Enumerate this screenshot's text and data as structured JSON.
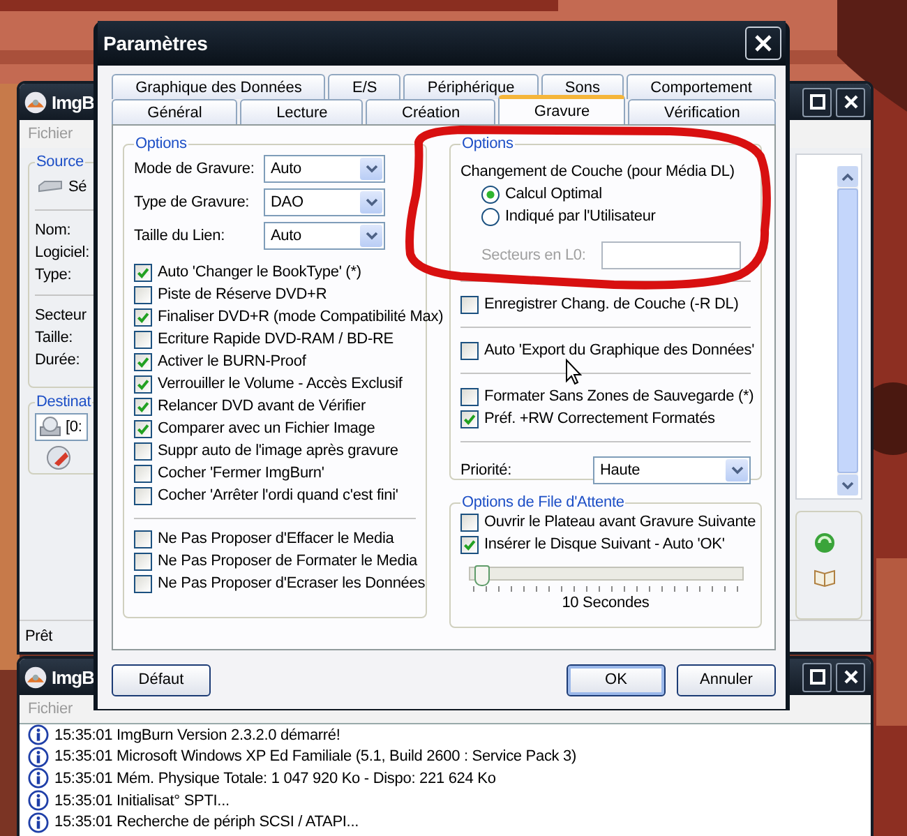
{
  "main_window": {
    "title": "ImgB",
    "menu": [
      "Fichier"
    ],
    "source": {
      "title": "Source",
      "drive": "Sé",
      "fields": [
        "Nom:",
        "Logiciel:",
        "Type:"
      ],
      "fields_2": [
        "Secteur",
        "Taille:",
        "Durée:"
      ]
    },
    "destination": {
      "title": "Destinat",
      "drive": "[0:"
    },
    "status_bar": "Prêt"
  },
  "log_window": {
    "title": "ImgB",
    "menu": [
      "Fichier"
    ],
    "lines": [
      "15:35:01 ImgBurn Version 2.3.2.0 démarré!",
      "15:35:01 Microsoft Windows XP Ed Familiale (5.1, Build 2600 : Service Pack 3)",
      "15:35:01 Mém. Physique Totale: 1 047 920 Ko  -  Dispo: 221 624 Ko",
      "15:35:01 Initialisat° SPTI...",
      "15:35:01 Recherche de périph SCSI / ATAPI..."
    ]
  },
  "dialog": {
    "title": "Paramètres",
    "tabs_back": [
      {
        "label": "Graphique des Données",
        "selected": false
      },
      {
        "label": "E/S",
        "selected": false
      },
      {
        "label": "Périphérique",
        "selected": false
      },
      {
        "label": "Sons",
        "selected": false
      },
      {
        "label": "Comportement",
        "selected": false
      }
    ],
    "tabs_front": [
      {
        "label": "Général",
        "selected": false
      },
      {
        "label": "Lecture",
        "selected": false
      },
      {
        "label": "Création",
        "selected": false
      },
      {
        "label": "Gravure",
        "selected": true
      },
      {
        "label": "Vérification",
        "selected": false
      }
    ],
    "options": {
      "title": "Options",
      "dropdowns": [
        {
          "label": "Mode de Gravure:",
          "value": "Auto"
        },
        {
          "label": "Type de Gravure:",
          "value": "DAO"
        },
        {
          "label": "Taille du Lien:",
          "value": "Auto"
        }
      ],
      "checkboxes": [
        {
          "label": "Auto 'Changer le BookType' (*)",
          "checked": true
        },
        {
          "label": "Piste de Réserve DVD+R",
          "checked": false
        },
        {
          "label": "Finaliser DVD+R (mode Compatibilité Max)",
          "checked": true
        },
        {
          "label": "Ecriture Rapide DVD-RAM / BD-RE",
          "checked": false
        },
        {
          "label": "Activer le BURN-Proof",
          "checked": true
        },
        {
          "label": "Verrouiller le Volume - Accès Exclusif",
          "checked": true
        },
        {
          "label": "Relancer DVD avant de Vérifier",
          "checked": true
        },
        {
          "label": "Comparer avec un Fichier Image",
          "checked": true
        },
        {
          "label": "Suppr auto de l'image après gravure",
          "checked": false
        },
        {
          "label": "Cocher 'Fermer ImgBurn'",
          "checked": false
        },
        {
          "label": "Cocher 'Arrêter l'ordi quand c'est fini'",
          "checked": false
        }
      ],
      "checkboxes_2": [
        {
          "label": "Ne Pas Proposer d'Effacer le Media",
          "checked": false
        },
        {
          "label": "Ne Pas Proposer de Formater le Media",
          "checked": false
        },
        {
          "label": "Ne Pas Proposer d'Ecraser les Données",
          "checked": false
        }
      ]
    },
    "layer_options": {
      "title": "Options",
      "heading": "Changement de Couche (pour Média DL)",
      "radios": [
        {
          "label": "Calcul Optimal",
          "selected": true
        },
        {
          "label": "Indiqué par l'Utilisateur",
          "selected": false
        }
      ],
      "sectors_label": "Secteurs en L0:",
      "sectors_disabled": true,
      "checkbox_sections": [
        [
          {
            "label": "Enregistrer Chang. de Couche (-R DL)",
            "checked": false
          }
        ],
        [
          {
            "label": "Auto 'Export du Graphique des Données'",
            "checked": false
          }
        ],
        [
          {
            "label": "Formater Sans Zones de Sauvegarde (*)",
            "checked": false
          },
          {
            "label": "Préf. +RW Correctement Formatés",
            "checked": true
          }
        ]
      ],
      "priority_label": "Priorité:",
      "priority": "Haute"
    },
    "queue_options": {
      "title": "Options de File d'Attente",
      "checkboxes": [
        {
          "label": "Ouvrir le Plateau avant Gravure Suivante",
          "checked": false
        },
        {
          "label": "Insérer le Disque Suivant - Auto 'OK'",
          "checked": true
        }
      ],
      "slider": {
        "level": 0.03
      },
      "reading": "10 Secondes"
    },
    "buttons": {
      "default": "Défaut",
      "ok": "OK",
      "cancel": "Annuler"
    }
  }
}
